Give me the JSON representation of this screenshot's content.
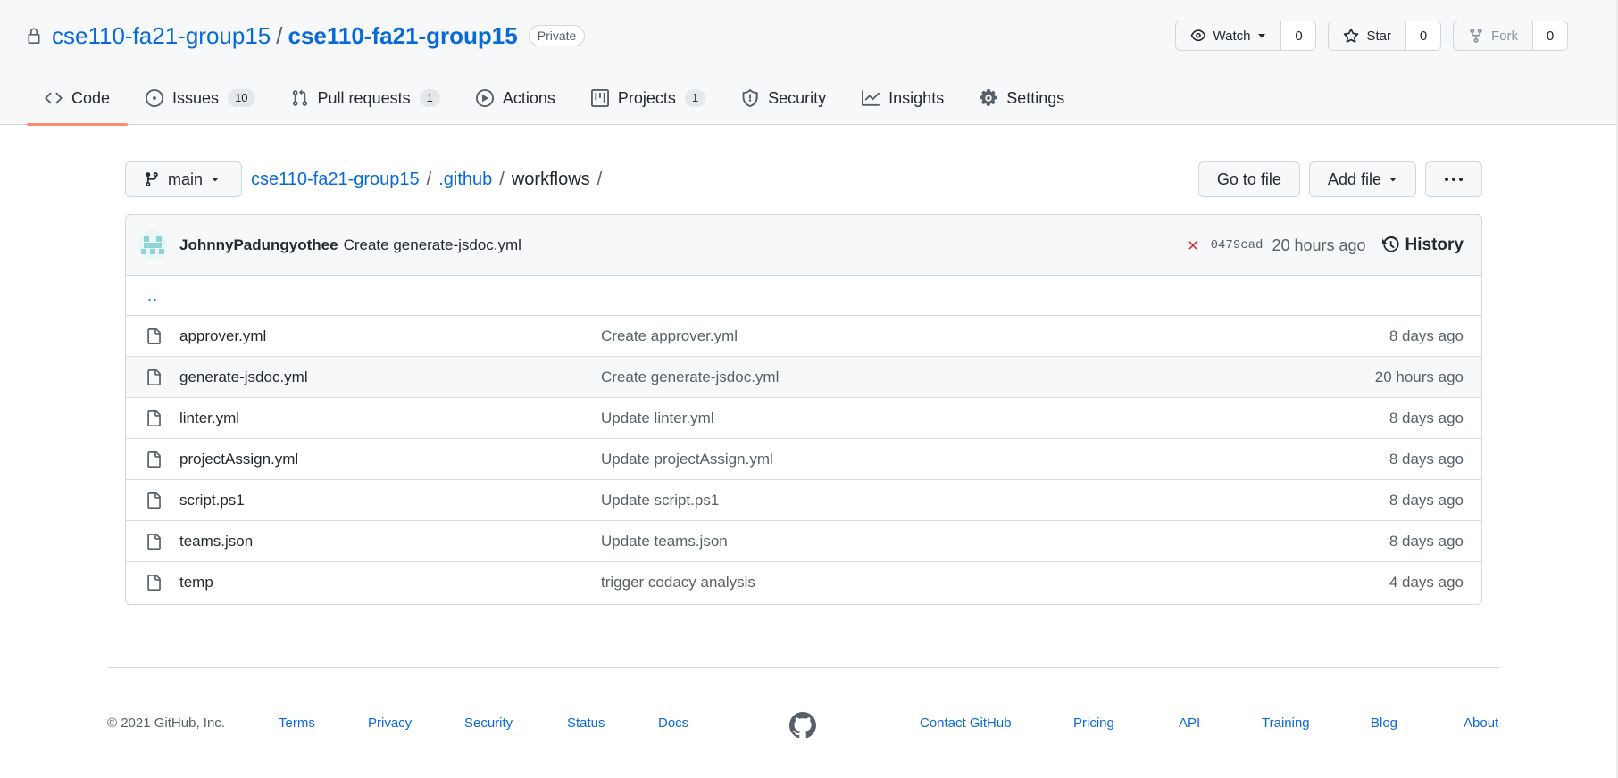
{
  "repo": {
    "owner": "cse110-fa21-group15",
    "name": "cse110-fa21-group15",
    "visibility": "Private",
    "separator": "/"
  },
  "actions": {
    "watch_label": "Watch",
    "watch_count": "0",
    "star_label": "Star",
    "star_count": "0",
    "fork_label": "Fork",
    "fork_count": "0"
  },
  "nav": {
    "code": "Code",
    "issues": "Issues",
    "issues_count": "10",
    "pulls": "Pull requests",
    "pulls_count": "1",
    "actions": "Actions",
    "projects": "Projects",
    "projects_count": "1",
    "security": "Security",
    "insights": "Insights",
    "settings": "Settings"
  },
  "file_nav": {
    "branch": "main",
    "crumb_root": "cse110-fa21-group15",
    "crumb_dir": ".github",
    "crumb_current": "workflows",
    "sep": "/",
    "go_to_file": "Go to file",
    "add_file": "Add file",
    "more": "···"
  },
  "commit": {
    "author": "JohnnyPadungyothee",
    "message": "Create generate-jsdoc.yml",
    "status": "failed",
    "sha": "0479cad",
    "age": "20 hours ago",
    "history": "History"
  },
  "up_dir": "..",
  "files": [
    {
      "name": "approver.yml",
      "message": "Create approver.yml",
      "age": "8 days ago"
    },
    {
      "name": "generate-jsdoc.yml",
      "message": "Create generate-jsdoc.yml",
      "age": "20 hours ago"
    },
    {
      "name": "linter.yml",
      "message": "Update linter.yml",
      "age": "8 days ago"
    },
    {
      "name": "projectAssign.yml",
      "message": "Update projectAssign.yml",
      "age": "8 days ago"
    },
    {
      "name": "script.ps1",
      "message": "Update script.ps1",
      "age": "8 days ago"
    },
    {
      "name": "teams.json",
      "message": "Update teams.json",
      "age": "8 days ago"
    },
    {
      "name": "temp",
      "message": "trigger codacy analysis",
      "age": "4 days ago"
    }
  ],
  "footer": {
    "copyright": "© 2021 GitHub, Inc.",
    "terms": "Terms",
    "privacy": "Privacy",
    "security": "Security",
    "status": "Status",
    "docs": "Docs",
    "contact": "Contact GitHub",
    "pricing": "Pricing",
    "api": "API",
    "training": "Training",
    "blog": "Blog",
    "about": "About"
  },
  "colors": {
    "link": "#0969da",
    "nav_underline": "#fd8c73",
    "failure": "#cf222e",
    "header_bg": "#f6f8fa",
    "border": "#d0d7de"
  }
}
